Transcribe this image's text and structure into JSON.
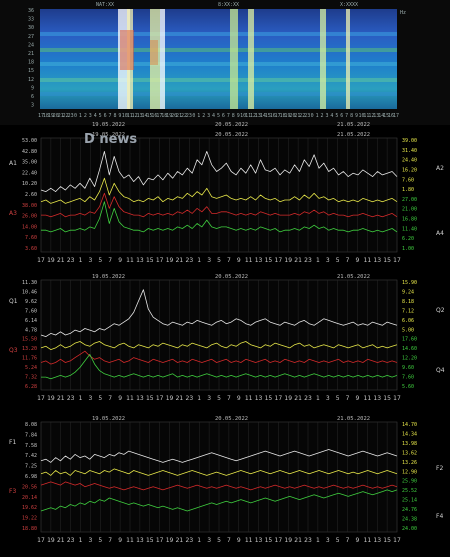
{
  "colors": {
    "white": "#e8e8e8",
    "yellow": "#e8e84a",
    "red": "#d42a2a",
    "green": "#3fcf3f",
    "left_label": "#d0d0d0",
    "right_label": "#d0d0d0"
  },
  "watermark": "D news",
  "spectrogram": {
    "title_labels": [
      "NAT:XX",
      "8:XX:XX",
      "X:XXXX"
    ],
    "y_ticks": [
      "36",
      "33",
      "30",
      "27",
      "24",
      "21",
      "18",
      "15",
      "12",
      "9",
      "6",
      "3"
    ],
    "x_dates": [
      "19.05.2022",
      "20.05.2022",
      "21.05.2022"
    ],
    "unit": "Hz"
  },
  "chart_data": [
    {
      "type": "line",
      "title": "",
      "x": [
        "17",
        "19",
        "21",
        "23",
        "1",
        "3",
        "5",
        "7",
        "9",
        "11",
        "13",
        "15",
        "17",
        "19",
        "21",
        "23",
        "1",
        "3",
        "5",
        "7",
        "9",
        "11",
        "13",
        "15",
        "17",
        "19",
        "21",
        "23",
        "1",
        "3",
        "5",
        "7",
        "9",
        "11",
        "13",
        "15",
        "17"
      ],
      "dates": [
        "19.05.2022",
        "20.05.2022",
        "21.05.2022"
      ],
      "left_scale": [
        "53.00",
        "42.80",
        "35.00",
        "22.40",
        "10.20",
        "2.60",
        "38.00",
        "26.00",
        "14.00",
        "7.60",
        "3.60"
      ],
      "right_scale": [
        "39.00",
        "31.40",
        "24.40",
        "16.20",
        "7.60",
        "1.80",
        "27.00",
        "21.00",
        "16.80",
        "11.40",
        "6.20",
        "1.00"
      ],
      "left_labels": [
        "A1",
        "A3"
      ],
      "right_labels": [
        "A2",
        "A4"
      ],
      "series": [
        {
          "color": "white",
          "values": [
            37,
            36,
            38,
            36,
            39,
            37,
            40,
            38,
            41,
            38,
            44,
            39,
            49,
            60,
            46,
            57,
            48,
            44,
            46,
            42,
            45,
            40,
            44,
            43,
            46,
            43,
            47,
            44,
            48,
            46,
            50,
            47,
            55,
            52,
            60,
            52,
            48,
            50,
            53,
            48,
            46,
            50,
            47,
            52,
            47,
            55,
            49,
            48,
            50,
            46,
            49,
            47,
            52,
            48,
            55,
            51,
            58,
            50,
            53,
            48,
            50,
            46,
            48,
            45,
            47,
            46,
            49,
            47,
            45,
            48,
            46,
            47,
            48,
            45
          ]
        },
        {
          "color": "yellow",
          "values": [
            30,
            31,
            29,
            30,
            31,
            29,
            30,
            31,
            32,
            30,
            33,
            31,
            36,
            44,
            34,
            41,
            36,
            33,
            32,
            30,
            31,
            30,
            32,
            31,
            33,
            30,
            32,
            31,
            33,
            32,
            35,
            33,
            36,
            34,
            38,
            33,
            32,
            33,
            34,
            32,
            31,
            32,
            31,
            33,
            31,
            34,
            32,
            31,
            32,
            30,
            31,
            31,
            33,
            31,
            34,
            32,
            35,
            32,
            33,
            31,
            32,
            30,
            31,
            30,
            31,
            30,
            32,
            31,
            30,
            31,
            30,
            31,
            32,
            30
          ]
        },
        {
          "color": "red",
          "values": [
            22,
            22,
            21,
            22,
            23,
            21,
            22,
            22,
            23,
            22,
            24,
            23,
            27,
            35,
            26,
            33,
            27,
            24,
            23,
            22,
            22,
            21,
            23,
            22,
            23,
            22,
            23,
            22,
            24,
            23,
            25,
            23,
            26,
            24,
            27,
            23,
            23,
            24,
            24,
            23,
            22,
            23,
            22,
            23,
            22,
            24,
            23,
            22,
            23,
            22,
            22,
            22,
            23,
            22,
            24,
            23,
            25,
            23,
            24,
            22,
            23,
            22,
            22,
            21,
            22,
            22,
            23,
            22,
            21,
            22,
            21,
            22,
            23,
            21
          ]
        },
        {
          "color": "green",
          "values": [
            13,
            13,
            12,
            13,
            14,
            12,
            13,
            13,
            14,
            13,
            15,
            14,
            20,
            30,
            17,
            26,
            18,
            15,
            14,
            13,
            13,
            12,
            14,
            13,
            14,
            13,
            14,
            13,
            15,
            14,
            16,
            14,
            17,
            15,
            19,
            15,
            14,
            15,
            15,
            14,
            13,
            14,
            13,
            14,
            13,
            15,
            14,
            13,
            14,
            12,
            13,
            13,
            14,
            13,
            15,
            14,
            16,
            14,
            15,
            13,
            14,
            13,
            13,
            12,
            13,
            13,
            14,
            13,
            12,
            13,
            12,
            13,
            14,
            12
          ]
        }
      ]
    },
    {
      "type": "line",
      "title": "",
      "x": [
        "17",
        "19",
        "21",
        "23",
        "1",
        "3",
        "5",
        "7",
        "9",
        "11",
        "13",
        "15",
        "17",
        "19",
        "21",
        "23",
        "1",
        "3",
        "5",
        "7",
        "9",
        "11",
        "13",
        "15",
        "17",
        "19",
        "21",
        "23",
        "1",
        "3",
        "5",
        "7",
        "9",
        "11",
        "13",
        "15",
        "17"
      ],
      "dates": [
        "19.05.2022",
        "20.05.2022",
        "21.05.2022"
      ],
      "left_scale": [
        "11.30",
        "10.46",
        "9.62",
        "7.60",
        "6.14",
        "4.78",
        "15.50",
        "13.20",
        "11.76",
        "5.24",
        "7.32",
        "6.28"
      ],
      "right_scale": [
        "15.90",
        "9.24",
        "8.18",
        "7.12",
        "6.06",
        "5.00",
        "17.60",
        "14.60",
        "12.20",
        "9.60",
        "7.60",
        "5.60"
      ],
      "left_labels": [
        "Q1",
        "Q3"
      ],
      "right_labels": [
        "Q2",
        "Q4"
      ],
      "series": [
        {
          "color": "white",
          "values": [
            34,
            33,
            35,
            34,
            36,
            34,
            35,
            37,
            36,
            38,
            37,
            36,
            38,
            37,
            39,
            41,
            40,
            42,
            44,
            48,
            55,
            62,
            50,
            45,
            43,
            41,
            40,
            42,
            41,
            40,
            42,
            41,
            43,
            42,
            41,
            40,
            42,
            43,
            41,
            42,
            44,
            43,
            41,
            40,
            42,
            43,
            44,
            42,
            41,
            40,
            42,
            41,
            40,
            42,
            43,
            41,
            40,
            42,
            44,
            43,
            42,
            41,
            40,
            41,
            42,
            40,
            41,
            40,
            42,
            41,
            40,
            42,
            41,
            40
          ]
        },
        {
          "color": "yellow",
          "values": [
            26,
            27,
            25,
            26,
            28,
            26,
            27,
            29,
            30,
            28,
            27,
            29,
            30,
            28,
            27,
            26,
            28,
            29,
            27,
            26,
            28,
            27,
            26,
            28,
            27,
            29,
            28,
            27,
            26,
            28,
            27,
            29,
            28,
            27,
            26,
            28,
            29,
            27,
            26,
            28,
            27,
            29,
            30,
            28,
            27,
            26,
            28,
            27,
            29,
            28,
            27,
            26,
            28,
            29,
            27,
            28,
            26,
            27,
            28,
            27,
            26,
            28,
            27,
            26,
            27,
            28,
            26,
            27,
            28,
            26,
            27,
            26,
            27,
            28
          ]
        },
        {
          "color": "red",
          "values": [
            17,
            18,
            16,
            17,
            19,
            17,
            18,
            20,
            22,
            24,
            21,
            19,
            20,
            18,
            17,
            18,
            19,
            17,
            18,
            20,
            19,
            18,
            17,
            19,
            18,
            17,
            18,
            19,
            17,
            18,
            17,
            19,
            18,
            17,
            18,
            19,
            17,
            18,
            19,
            17,
            18,
            17,
            19,
            18,
            17,
            18,
            19,
            17,
            18,
            17,
            19,
            18,
            17,
            18,
            17,
            19,
            18,
            17,
            18,
            17,
            18,
            19,
            17,
            18,
            17,
            18,
            17,
            19,
            18,
            17,
            18,
            17,
            18,
            17
          ]
        },
        {
          "color": "green",
          "values": [
            8,
            8,
            7,
            8,
            9,
            8,
            9,
            11,
            14,
            18,
            22,
            16,
            12,
            10,
            9,
            8,
            9,
            8,
            9,
            10,
            9,
            8,
            9,
            8,
            9,
            8,
            9,
            10,
            8,
            9,
            8,
            9,
            8,
            9,
            10,
            9,
            8,
            9,
            8,
            9,
            8,
            9,
            10,
            9,
            8,
            9,
            8,
            9,
            8,
            9,
            10,
            9,
            8,
            9,
            8,
            9,
            10,
            9,
            8,
            9,
            8,
            9,
            8,
            9,
            8,
            9,
            8,
            9,
            8,
            9,
            8,
            9,
            8,
            9
          ]
        }
      ]
    },
    {
      "type": "line",
      "title": "",
      "x": [
        "17",
        "19",
        "21",
        "23",
        "1",
        "3",
        "5",
        "7",
        "9",
        "11",
        "13",
        "15",
        "17",
        "19",
        "21",
        "23",
        "1",
        "3",
        "5",
        "7",
        "9",
        "11",
        "13",
        "15",
        "17",
        "19",
        "21",
        "23",
        "1",
        "3",
        "5",
        "7",
        "9",
        "11",
        "13",
        "15",
        "17"
      ],
      "dates": [
        "19.05.2022",
        "20.05.2022",
        "21.05.2022"
      ],
      "left_scale": [
        "8.08",
        "7.84",
        "7.58",
        "7.42",
        "7.25",
        "6.98",
        "20.56",
        "20.14",
        "19.62",
        "19.22",
        "18.80"
      ],
      "right_scale": [
        "14.70",
        "14.34",
        "13.98",
        "13.62",
        "13.26",
        "12.90",
        "25.90",
        "25.52",
        "25.14",
        "24.76",
        "24.38",
        "24.00"
      ],
      "left_labels": [
        "F1",
        "F3"
      ],
      "right_labels": [
        "F2",
        "F4"
      ],
      "series": [
        {
          "color": "white",
          "values": [
            44,
            45,
            43,
            46,
            44,
            47,
            45,
            48,
            46,
            47,
            45,
            48,
            47,
            46,
            48,
            47,
            49,
            48,
            50,
            49,
            48,
            47,
            46,
            45,
            44,
            43,
            44,
            45,
            44,
            43,
            44,
            45,
            46,
            47,
            48,
            49,
            48,
            47,
            46,
            45,
            44,
            45,
            46,
            47,
            48,
            49,
            50,
            49,
            48,
            47,
            48,
            49,
            50,
            49,
            48,
            47,
            48,
            49,
            50,
            51,
            50,
            49,
            48,
            47,
            48,
            49,
            50,
            49,
            48,
            47,
            48,
            49,
            48,
            47
          ]
        },
        {
          "color": "yellow",
          "values": [
            36,
            37,
            35,
            38,
            36,
            37,
            35,
            38,
            37,
            36,
            38,
            37,
            36,
            38,
            37,
            39,
            38,
            37,
            36,
            38,
            37,
            36,
            35,
            36,
            37,
            38,
            37,
            36,
            35,
            36,
            37,
            38,
            37,
            36,
            35,
            36,
            37,
            36,
            35,
            36,
            37,
            38,
            37,
            36,
            37,
            38,
            37,
            36,
            37,
            38,
            37,
            36,
            37,
            38,
            37,
            36,
            37,
            38,
            37,
            36,
            37,
            38,
            37,
            36,
            37,
            36,
            37,
            38,
            37,
            36,
            37,
            38,
            37,
            36
          ]
        },
        {
          "color": "red",
          "values": [
            29,
            30,
            31,
            30,
            29,
            31,
            30,
            29,
            30,
            28,
            29,
            30,
            29,
            28,
            27,
            28,
            27,
            26,
            27,
            28,
            27,
            26,
            27,
            28,
            27,
            26,
            27,
            28,
            29,
            28,
            27,
            28,
            29,
            28,
            27,
            28,
            27,
            28,
            29,
            28,
            27,
            28,
            27,
            26,
            27,
            28,
            27,
            28,
            29,
            28,
            27,
            28,
            27,
            28,
            29,
            28,
            27,
            28,
            27,
            28,
            29,
            28,
            27,
            28,
            27,
            28,
            29,
            28,
            27,
            28,
            27,
            28,
            29,
            28
          ]
        },
        {
          "color": "green",
          "values": [
            13,
            14,
            15,
            14,
            16,
            15,
            17,
            16,
            18,
            17,
            19,
            18,
            20,
            19,
            21,
            20,
            19,
            18,
            17,
            18,
            17,
            16,
            17,
            16,
            15,
            16,
            15,
            14,
            15,
            14,
            13,
            14,
            15,
            16,
            17,
            18,
            17,
            18,
            19,
            18,
            19,
            20,
            19,
            18,
            19,
            20,
            21,
            20,
            19,
            20,
            21,
            22,
            21,
            20,
            21,
            22,
            23,
            22,
            21,
            22,
            23,
            24,
            23,
            22,
            23,
            24,
            25,
            24,
            23,
            24,
            25,
            26,
            25,
            26
          ]
        }
      ]
    }
  ]
}
